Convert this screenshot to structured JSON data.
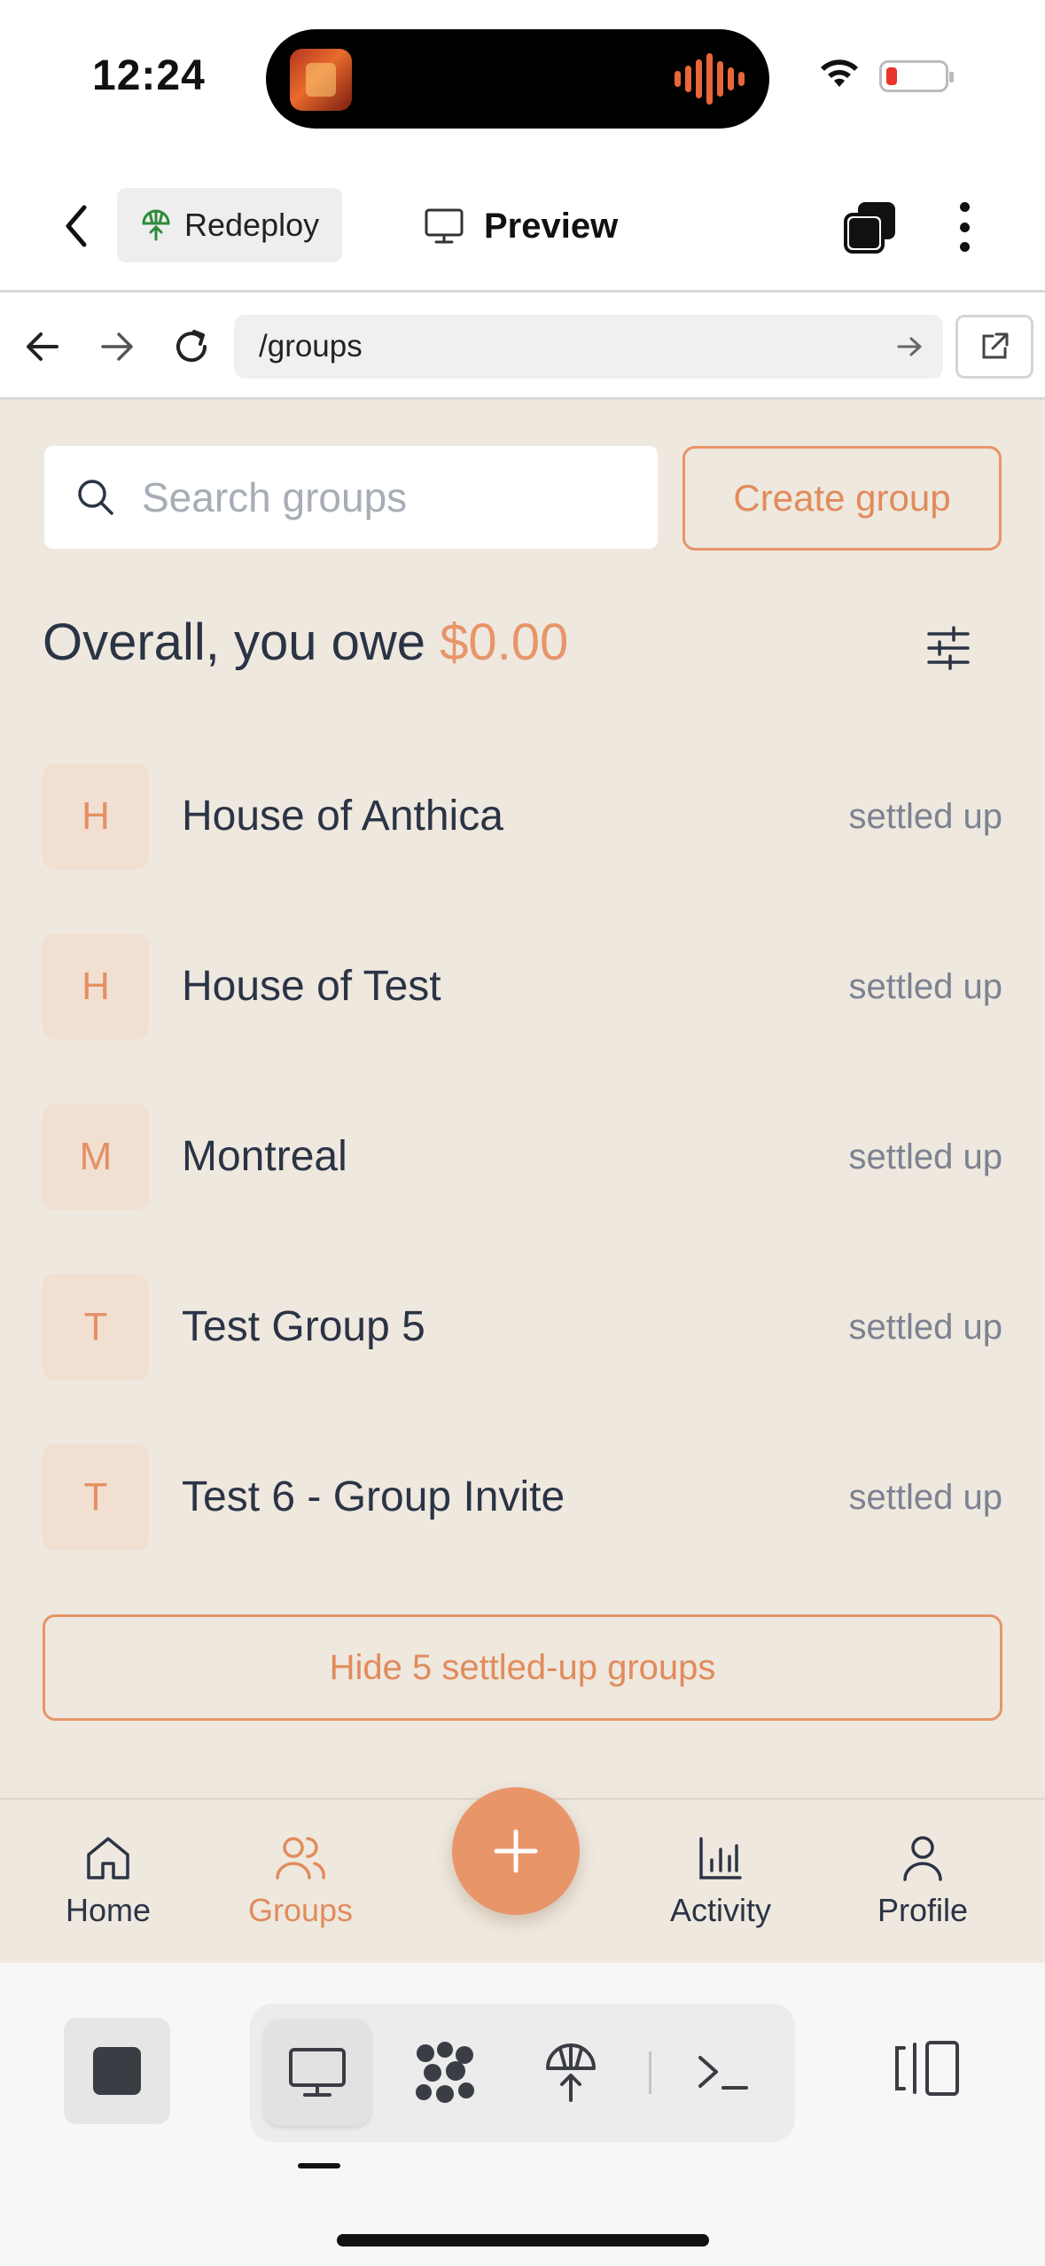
{
  "status_bar": {
    "time": "12:24"
  },
  "toolbar": {
    "redeploy_label": "Redeploy",
    "preview_label": "Preview"
  },
  "browser": {
    "url": "/groups"
  },
  "groups_page": {
    "search_placeholder": "Search groups",
    "create_button": "Create group",
    "overall_prefix": "Overall, you owe",
    "overall_amount": "$0.00",
    "groups": [
      {
        "initial": "H",
        "name": "House of Anthica",
        "status": "settled up"
      },
      {
        "initial": "H",
        "name": "House of Test",
        "status": "settled up"
      },
      {
        "initial": "M",
        "name": "Montreal",
        "status": "settled up"
      },
      {
        "initial": "T",
        "name": "Test Group 5",
        "status": "settled up"
      },
      {
        "initial": "T",
        "name": "Test 6 - Group Invite",
        "status": "settled up"
      }
    ],
    "hide_button": "Hide 5 settled-up groups"
  },
  "app_nav": {
    "home": "Home",
    "groups": "Groups",
    "activity": "Activity",
    "profile": "Profile"
  },
  "colors": {
    "accent": "#e8956a",
    "app_background": "#eee8df",
    "text": "#2b3445",
    "muted": "#7c8290"
  }
}
